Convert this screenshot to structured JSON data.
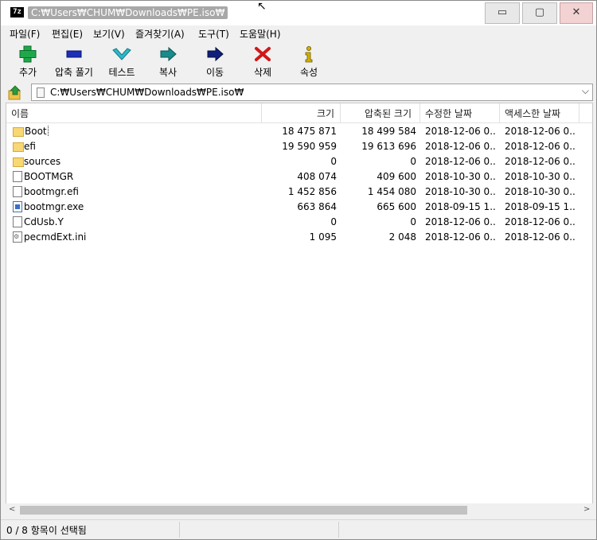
{
  "window": {
    "title": "C:₩Users₩CHUM₩Downloads₩PE.iso₩",
    "app_icon": "7z",
    "min_glyph": "▭",
    "max_glyph": "▢",
    "close_glyph": "✕"
  },
  "menu": [
    {
      "label": "파일(F)"
    },
    {
      "label": "편집(E)"
    },
    {
      "label": "보기(V)"
    },
    {
      "label": "즐겨찾기(A)"
    },
    {
      "label": "도구(T)"
    },
    {
      "label": "도움말(H)"
    }
  ],
  "toolbar": [
    {
      "label": "추가",
      "icon": "plus-icon",
      "color": "#1ea84a"
    },
    {
      "label": "압축 풀기",
      "icon": "minus-icon",
      "color": "#1c2fb5"
    },
    {
      "label": "테스트",
      "icon": "check-icon",
      "color": "#2fb8c8"
    },
    {
      "label": "복사",
      "icon": "copy-arrow-icon",
      "color": "#1a8a8a"
    },
    {
      "label": "이동",
      "icon": "move-arrow-icon",
      "color": "#10207a"
    },
    {
      "label": "삭제",
      "icon": "delete-x-icon",
      "color": "#d11818"
    },
    {
      "label": "속성",
      "icon": "info-icon",
      "color": "#d4b000"
    }
  ],
  "address": {
    "path": "C:₩Users₩CHUM₩Downloads₩PE.iso₩",
    "dropdown_glyph": "⌵"
  },
  "columns": {
    "name": "이름",
    "size": "크기",
    "packed": "압축된 크기",
    "modified": "수정한 날짜",
    "accessed": "액세스한 날짜"
  },
  "files": [
    {
      "name": "Boot",
      "type": "folder",
      "size": "18 475 871",
      "packed": "18 499 584",
      "modified": "2018-12-06 0...",
      "accessed": "2018-12-06 0..."
    },
    {
      "name": "efi",
      "type": "folder",
      "size": "19 590 959",
      "packed": "19 613 696",
      "modified": "2018-12-06 0...",
      "accessed": "2018-12-06 0..."
    },
    {
      "name": "sources",
      "type": "folder",
      "size": "0",
      "packed": "0",
      "modified": "2018-12-06 0...",
      "accessed": "2018-12-06 0..."
    },
    {
      "name": "BOOTMGR",
      "type": "file",
      "size": "408 074",
      "packed": "409 600",
      "modified": "2018-10-30 0...",
      "accessed": "2018-10-30 0..."
    },
    {
      "name": "bootmgr.efi",
      "type": "file",
      "size": "1 452 856",
      "packed": "1 454 080",
      "modified": "2018-10-30 0...",
      "accessed": "2018-10-30 0..."
    },
    {
      "name": "bootmgr.exe",
      "type": "exe",
      "size": "663 864",
      "packed": "665 600",
      "modified": "2018-09-15 1...",
      "accessed": "2018-09-15 1..."
    },
    {
      "name": "CdUsb.Y",
      "type": "file",
      "size": "0",
      "packed": "0",
      "modified": "2018-12-06 0...",
      "accessed": "2018-12-06 0..."
    },
    {
      "name": "pecmdExt.ini",
      "type": "ini",
      "size": "1 095",
      "packed": "2 048",
      "modified": "2018-12-06 0...",
      "accessed": "2018-12-06 0..."
    }
  ],
  "scrollbar": {
    "left_glyph": "<",
    "right_glyph": ">"
  },
  "status": {
    "text": "0 / 8 항목이 선택됨"
  },
  "cursor_glyph": "↖"
}
